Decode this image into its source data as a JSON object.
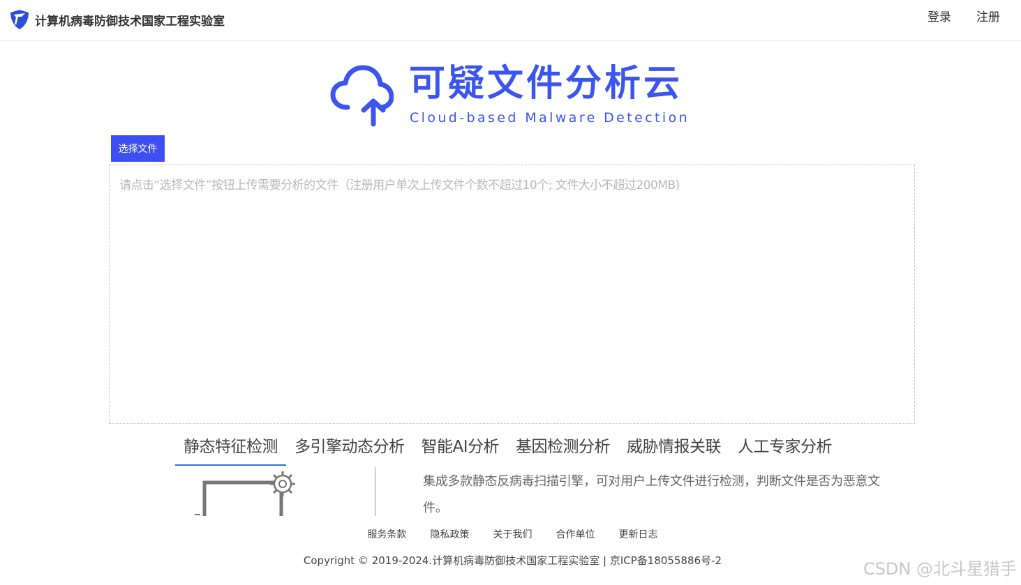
{
  "header": {
    "org_name": "计算机病毒防御技术国家工程实验室",
    "login_label": "登录",
    "register_label": "注册"
  },
  "brand": {
    "title": "可疑文件分析云",
    "subtitle": "Cloud-based Malware Detection",
    "accent_color": "#3a55f0"
  },
  "upload": {
    "button_label": "选择文件",
    "hint": "请点击“选择文件”按钮上传需要分析的文件（注册用户单次上传文件个数不超过10个; 文件大小不超过200MB)"
  },
  "tabs": [
    {
      "label": "静态特征检测",
      "active": true
    },
    {
      "label": "多引擎动态分析",
      "active": false
    },
    {
      "label": "智能AI分析",
      "active": false
    },
    {
      "label": "基因检测分析",
      "active": false
    },
    {
      "label": "威胁情报关联",
      "active": false
    },
    {
      "label": "人工专家分析",
      "active": false
    }
  ],
  "tab_content": {
    "description": "集成多款静态反病毒扫描引擎，可对用户上传文件进行检测，判断文件是否为恶意文件。",
    "illustration_icon": "gear-screen-icon"
  },
  "footer": {
    "links": [
      "服务条款",
      "隐私政策",
      "关于我们",
      "合作单位",
      "更新日志"
    ],
    "copyright": "Copyright © 2019-2024.计算机病毒防御技术国家工程实验室 | 京ICP备18055886号-2"
  },
  "watermark": "CSDN @北斗星猎手"
}
